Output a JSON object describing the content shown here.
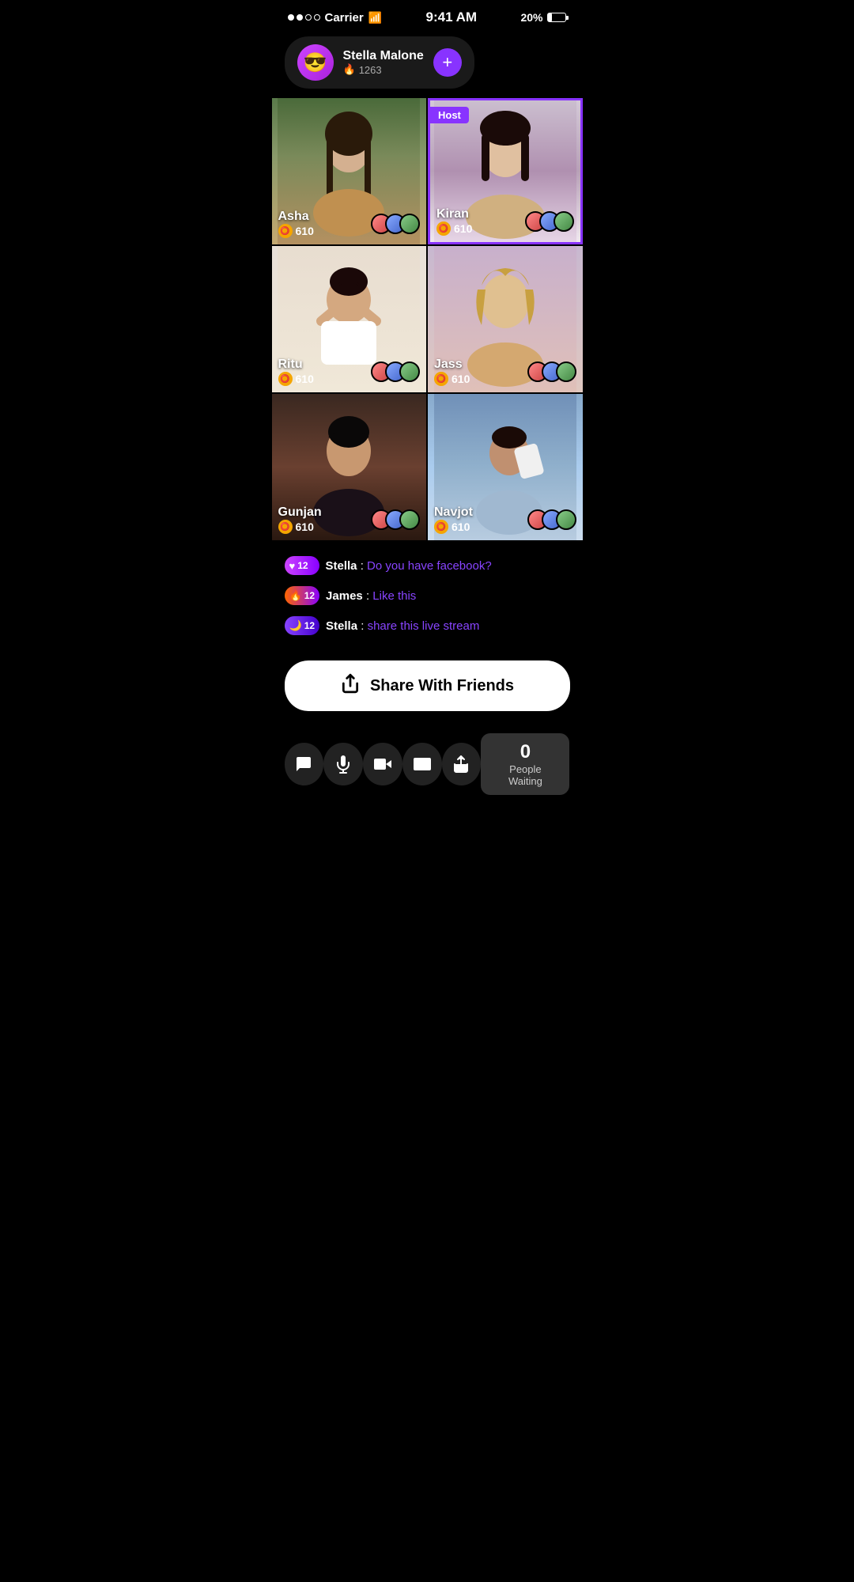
{
  "statusBar": {
    "carrier": "Carrier",
    "time": "9:41 AM",
    "battery": "20%"
  },
  "hostCard": {
    "name": "Stella Malone",
    "fireScore": "1263",
    "addLabel": "+"
  },
  "grid": [
    {
      "name": "Asha",
      "coins": "610",
      "isHost": false,
      "bgClass": "bg-asha"
    },
    {
      "name": "Kiran",
      "coins": "610",
      "isHost": true,
      "hostLabel": "Host",
      "bgClass": "bg-kiran"
    },
    {
      "name": "Ritu",
      "coins": "610",
      "isHost": false,
      "bgClass": "bg-ritu"
    },
    {
      "name": "Jass",
      "coins": "610",
      "isHost": false,
      "bgClass": "bg-jass"
    },
    {
      "name": "Gunjan",
      "coins": "610",
      "isHost": false,
      "bgClass": "bg-gunjan"
    },
    {
      "name": "Navjot",
      "coins": "610",
      "isHost": false,
      "bgClass": "bg-navjot"
    }
  ],
  "chat": [
    {
      "badgeType": "badge-heart",
      "badgeIcon": "♥",
      "badgeNum": "12",
      "username": "Stella",
      "separator": " : ",
      "message": "Do you have facebook?"
    },
    {
      "badgeType": "badge-fire",
      "badgeIcon": "🔥",
      "badgeNum": "12",
      "username": "James",
      "separator": " : ",
      "message": "Like this"
    },
    {
      "badgeType": "badge-moon",
      "badgeIcon": "🌙",
      "badgeNum": "12",
      "username": "Stella",
      "separator": " : ",
      "message": "share this live stream"
    }
  ],
  "shareButton": {
    "label": "Share With Friends"
  },
  "peopleWaiting": {
    "count": "0",
    "label": "People Waiting"
  }
}
